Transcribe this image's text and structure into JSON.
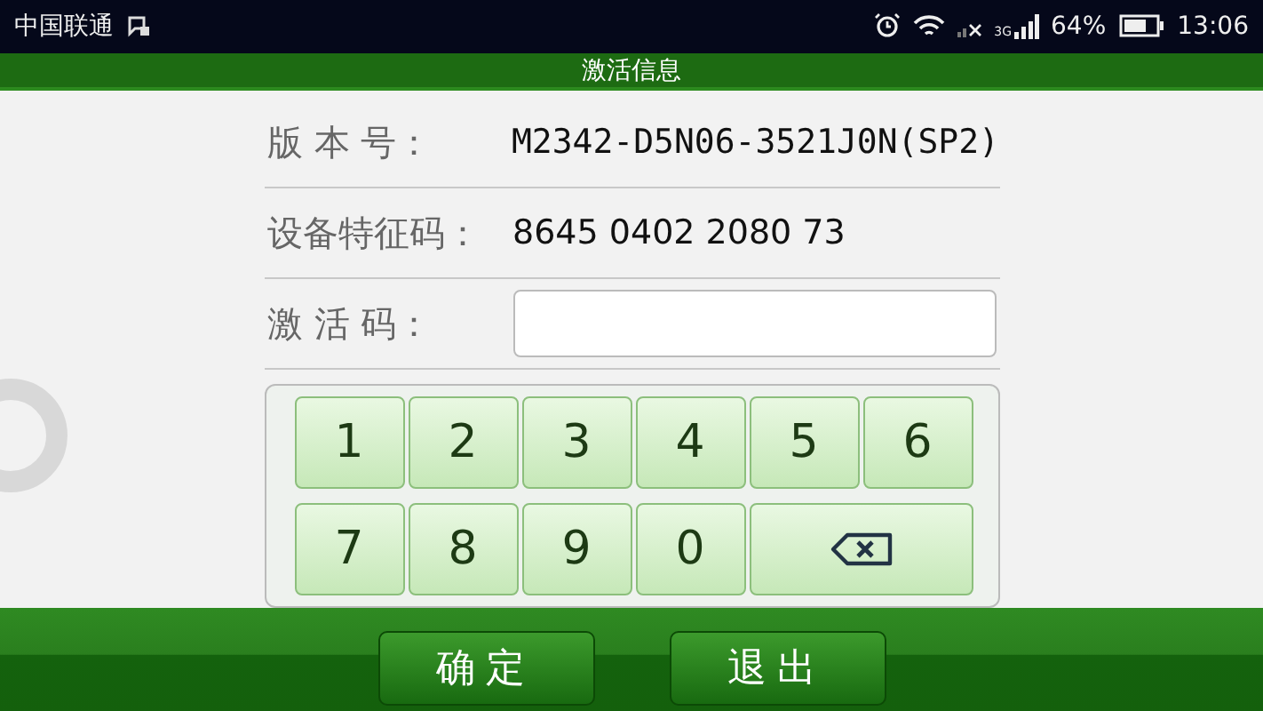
{
  "status_bar": {
    "carrier": "中国联通",
    "network_type": "3G",
    "battery_text": "64%",
    "time": "13:06"
  },
  "title": "激活信息",
  "fields": [
    {
      "kind": "text",
      "label": "版 本 号：",
      "value": "M2342-D5N06-3521J0N(SP2)"
    },
    {
      "kind": "text",
      "label": "设备特征码：",
      "value": "8645 0402 2080 73"
    },
    {
      "kind": "input",
      "label": "激 活 码："
    }
  ],
  "keypad": [
    {
      "kind": "digit",
      "label": "1"
    },
    {
      "kind": "digit",
      "label": "2"
    },
    {
      "kind": "digit",
      "label": "3"
    },
    {
      "kind": "digit",
      "label": "4"
    },
    {
      "kind": "digit",
      "label": "5"
    },
    {
      "kind": "digit",
      "label": "6"
    },
    {
      "kind": "digit",
      "label": "7"
    },
    {
      "kind": "digit",
      "label": "8"
    },
    {
      "kind": "digit",
      "label": "9"
    },
    {
      "kind": "digit",
      "label": "0"
    },
    {
      "kind": "backspace"
    }
  ],
  "buttons": [
    "确定",
    "退出"
  ]
}
